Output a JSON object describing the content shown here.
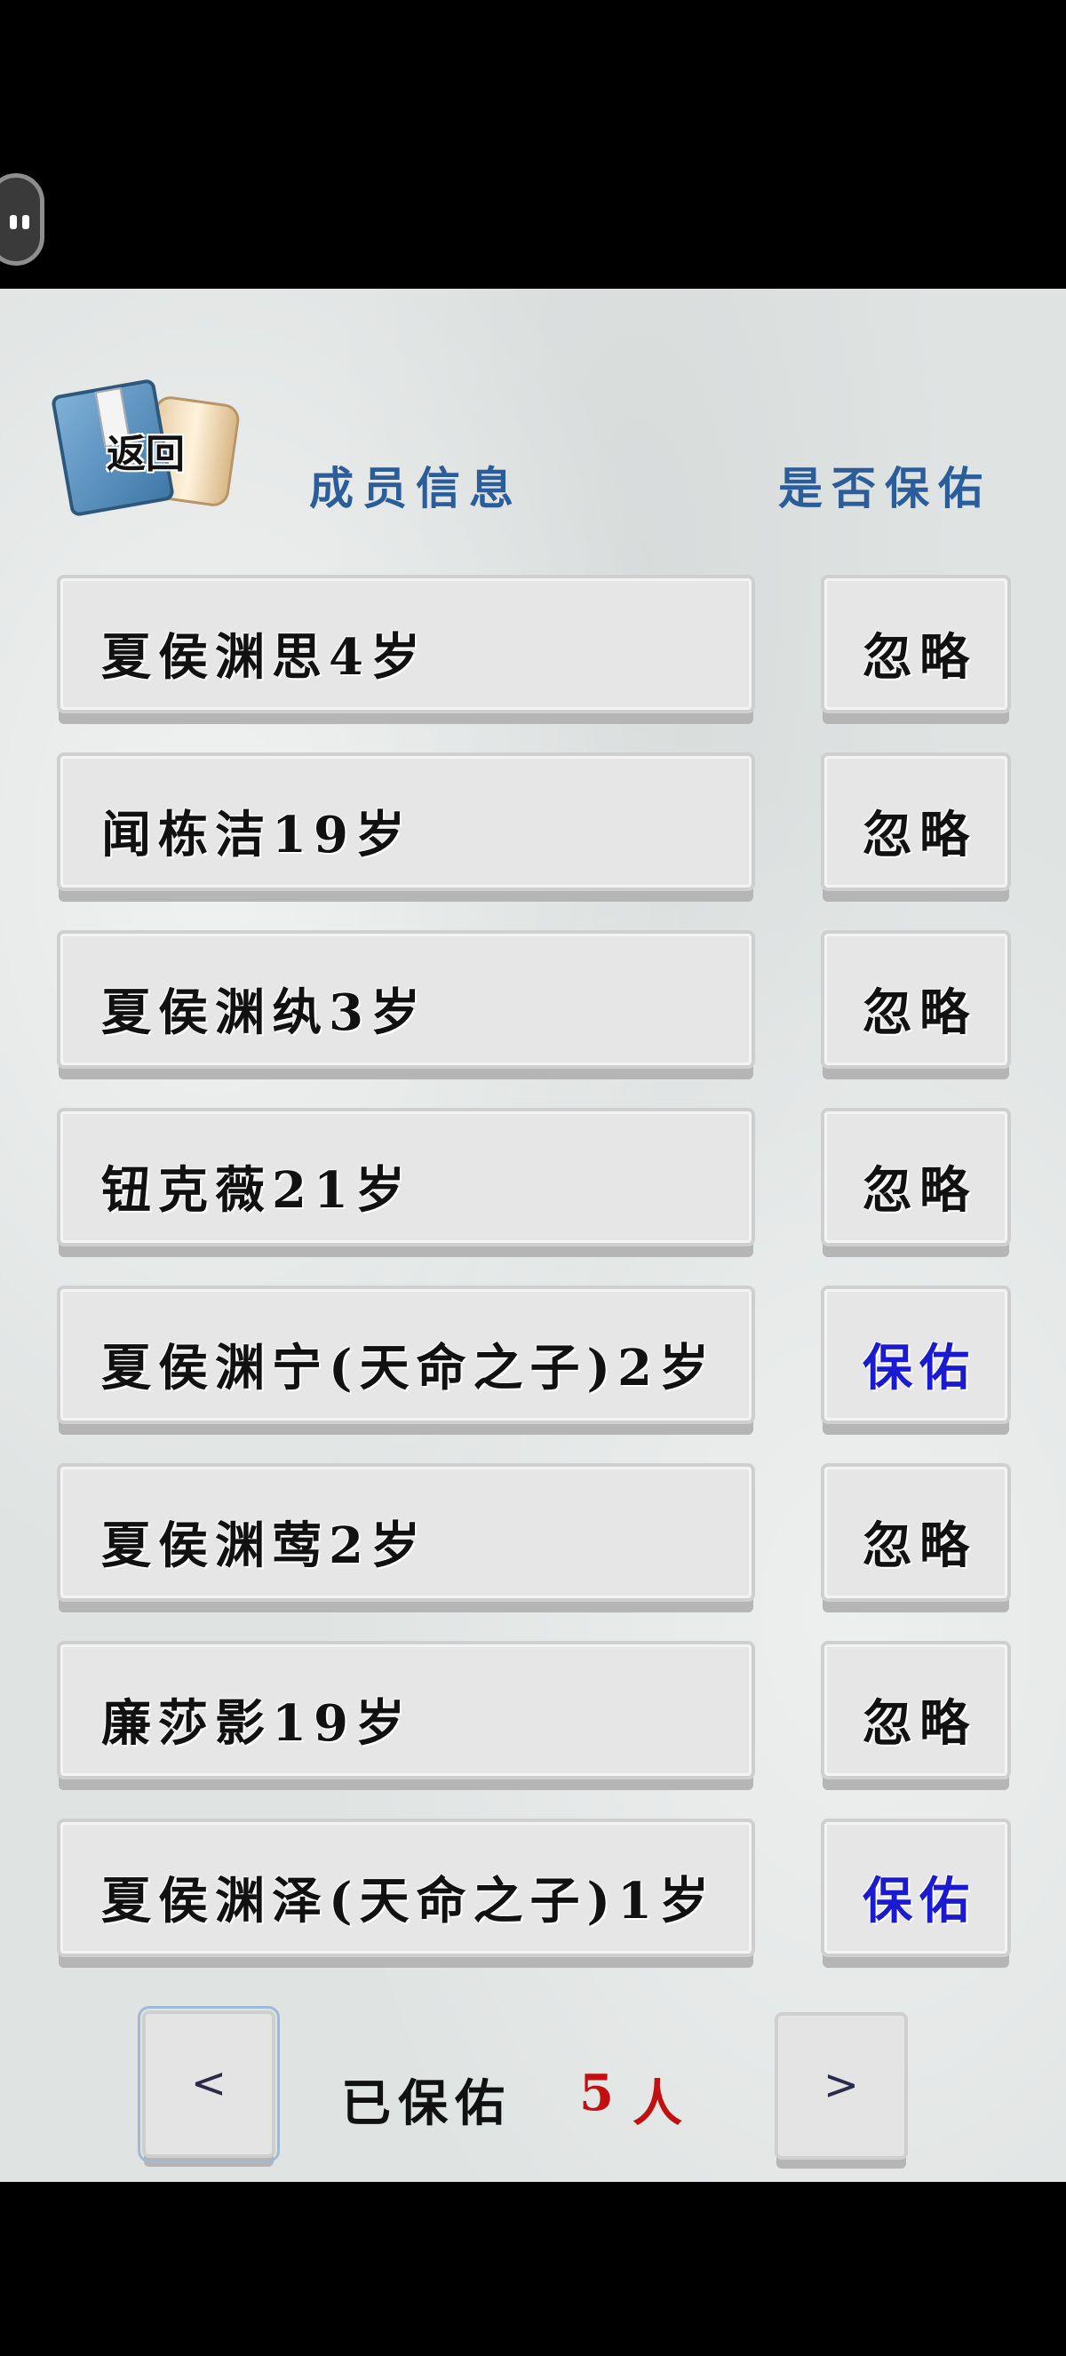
{
  "header": {
    "back_label": "返回",
    "col_member": "成员信息",
    "col_protect": "是否保佑"
  },
  "members": [
    {
      "name": "夏侯渊思4岁",
      "action": "忽略",
      "action_color": "#111111"
    },
    {
      "name": "闻栋洁19岁",
      "action": "忽略",
      "action_color": "#111111"
    },
    {
      "name": "夏侯渊纨3岁",
      "action": "忽略",
      "action_color": "#111111"
    },
    {
      "name": "钮克薇21岁",
      "action": "忽略",
      "action_color": "#111111"
    },
    {
      "name": "夏侯渊宁(天命之子)2岁",
      "action": "保佑",
      "action_color": "#1a1ad0"
    },
    {
      "name": "夏侯渊莺2岁",
      "action": "忽略",
      "action_color": "#111111"
    },
    {
      "name": "廉莎影19岁",
      "action": "忽略",
      "action_color": "#111111"
    },
    {
      "name": "夏侯渊泽(天命之子)1岁",
      "action": "保佑",
      "action_color": "#1a1ad0"
    }
  ],
  "footer": {
    "prev": "<",
    "next": ">",
    "label": "已保佑",
    "count": "5",
    "unit": "人"
  },
  "colors": {
    "header_blue": "#2a5d9a",
    "protect_blue": "#1a1ad0",
    "count_red": "#c21010"
  }
}
